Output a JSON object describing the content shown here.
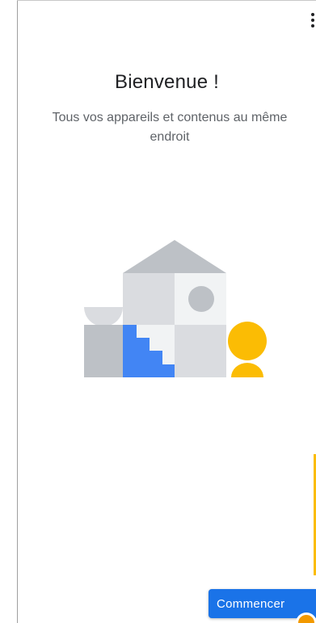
{
  "header": {
    "menu_icon": "more-vert-icon"
  },
  "welcome": {
    "title": "Bienvenue !",
    "subtitle": "Tous vos appareils et contenus au même endroit"
  },
  "illustration": {
    "icon": "house-blocks-illustration",
    "colors": {
      "roof": "#bdc1c6",
      "light_gray": "#dadce0",
      "mid_gray": "#bdc1c6",
      "white_block": "#f1f3f4",
      "circle": "#bdc1c6",
      "blue": "#4285f4",
      "yellow": "#fbbc04"
    }
  },
  "actions": {
    "start_label": "Commencer"
  },
  "colors": {
    "accent": "#1a73e8",
    "text_primary": "#202124",
    "text_secondary": "#5f6368"
  }
}
